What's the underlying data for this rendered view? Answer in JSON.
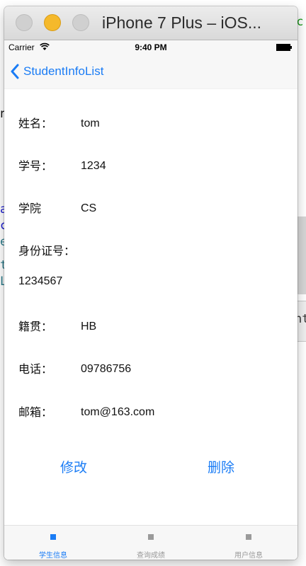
{
  "window": {
    "title": "iPhone 7 Plus – iOS..."
  },
  "background_fragments": {
    "top_right": "ec",
    "left_a": "a",
    "left_c": "c",
    "left_e": "e",
    "left_t": "t",
    "left_l": "L",
    "right_nt": "nt",
    "left_n": "n",
    "colors": {
      "green": "#1a9a1a",
      "blue": "#1a1ad0",
      "teal": "#2a7a8a"
    }
  },
  "status_bar": {
    "carrier": "Carrier",
    "time": "9:40 PM"
  },
  "nav": {
    "back_label": "StudentInfoList"
  },
  "fields": {
    "name": {
      "label": "姓名：",
      "value": "tom"
    },
    "id": {
      "label": "学号：",
      "value": "1234"
    },
    "college": {
      "label": "学院",
      "value": "CS"
    },
    "id_card": {
      "label": "身份证号：",
      "value": "1234567"
    },
    "native": {
      "label": "籍贯：",
      "value": "HB"
    },
    "phone": {
      "label": "电话：",
      "value": "09786756"
    },
    "email": {
      "label": "邮箱：",
      "value": "tom@163.com"
    }
  },
  "actions": {
    "edit_label": "修改",
    "delete_label": "删除"
  },
  "tabs": [
    {
      "label": "学生信息",
      "icon": "square-icon",
      "active": true
    },
    {
      "label": "查询成绩",
      "icon": "square-icon",
      "active": false
    },
    {
      "label": "用户信息",
      "icon": "square-icon",
      "active": false
    }
  ],
  "colors": {
    "accent": "#1a7cf5",
    "inactive": "#9a9a9a",
    "minimize": "#f5b92b"
  }
}
